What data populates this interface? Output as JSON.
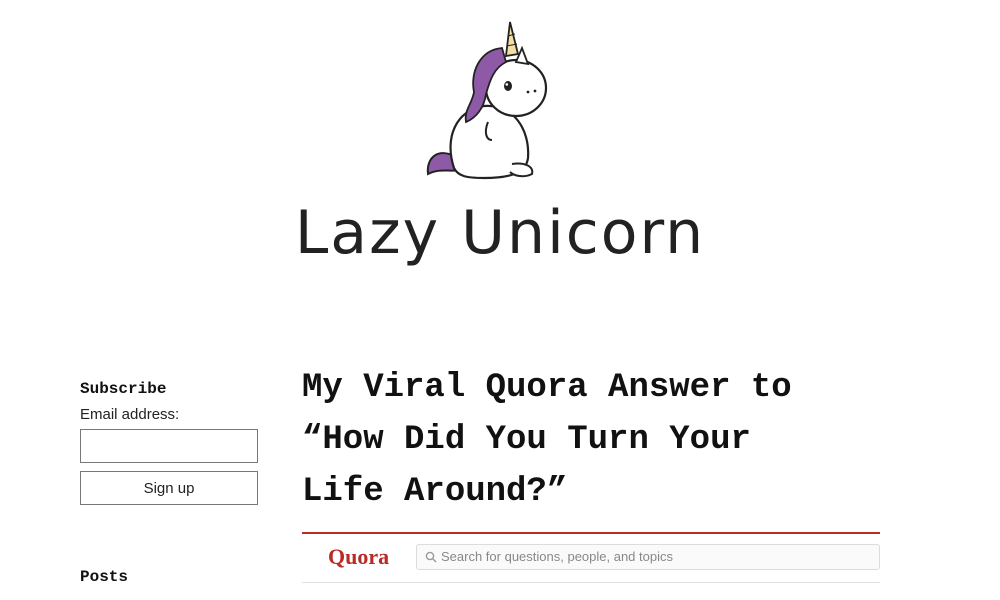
{
  "site": {
    "title": "Lazy Unicorn",
    "logo_icon": "unicorn-logo-icon"
  },
  "sidebar": {
    "subscribe_heading": "Subscribe",
    "email_label": "Email address:",
    "email_value": "",
    "signup_label": "Sign up",
    "posts_heading": "Posts"
  },
  "post": {
    "title_line1": "My Viral Quora Answer to",
    "title_line2": "“How Did You Turn Your",
    "title_line3": "Life Around?”",
    "embed": {
      "brand": "Quora",
      "brand_color": "#b92b27",
      "search_placeholder": "Search for questions, people, and topics",
      "search_icon": "search-icon"
    }
  }
}
